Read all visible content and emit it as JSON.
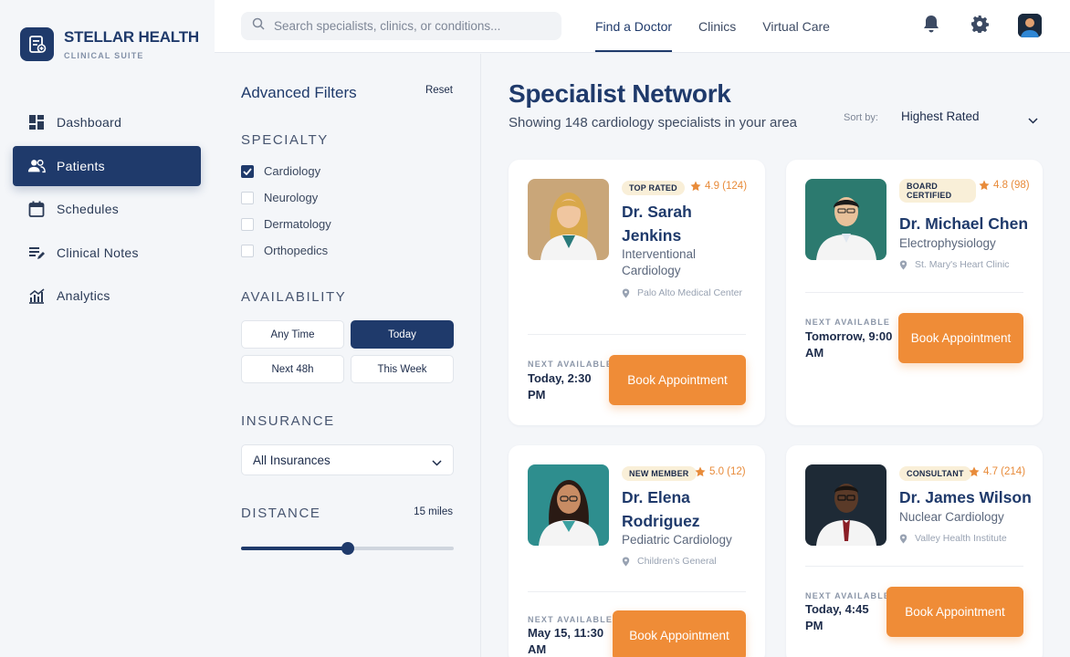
{
  "brand": {
    "name": "STELLAR HEALTH",
    "subtitle": "CLINICAL SUITE"
  },
  "sidebar": {
    "items": [
      {
        "label": "Dashboard",
        "icon": "dashboard-icon"
      },
      {
        "label": "Patients",
        "icon": "patients-icon",
        "active": true
      },
      {
        "label": "Schedules",
        "icon": "calendar-icon"
      },
      {
        "label": "Clinical Notes",
        "icon": "notes-icon"
      },
      {
        "label": "Analytics",
        "icon": "analytics-icon"
      }
    ]
  },
  "search": {
    "placeholder": "Search specialists, clinics, or conditions...",
    "value": ""
  },
  "tabs": [
    {
      "label": "Find a Doctor",
      "active": true
    },
    {
      "label": "Clinics"
    },
    {
      "label": "Virtual Care"
    }
  ],
  "filters": {
    "title": "Advanced Filters",
    "reset": "Reset",
    "specialty": {
      "heading": "SPECIALTY",
      "options": [
        {
          "label": "Cardiology",
          "checked": true
        },
        {
          "label": "Neurology",
          "checked": false
        },
        {
          "label": "Dermatology",
          "checked": false
        },
        {
          "label": "Orthopedics",
          "checked": false
        }
      ]
    },
    "availability": {
      "heading": "AVAILABILITY",
      "options": [
        "Any Time",
        "Today",
        "Next 48h",
        "This Week"
      ],
      "selected": "Today"
    },
    "insurance": {
      "heading": "INSURANCE",
      "value": "All Insurances"
    },
    "distance": {
      "heading": "DISTANCE",
      "value": "15 miles",
      "fraction": 0.5
    }
  },
  "main": {
    "title": "Specialist Network",
    "subtitle": "Showing 148 cardiology specialists in your area",
    "sort_label": "Sort by:",
    "sort_value": "Highest Rated",
    "next_available_label": "NEXT AVAILABLE",
    "book_label": "Book Appointment"
  },
  "doctors": [
    {
      "badge": "TOP RATED",
      "rating": "4.9 (124)",
      "name": "Dr. Sarah Jenkins",
      "specialty": "Interventional Cardiology",
      "location": "Palo Alto Medical Center",
      "next": "Today, 2:30 PM"
    },
    {
      "badge": "BOARD CERTIFIED",
      "rating": "4.8 (98)",
      "name": "Dr. Michael Chen",
      "specialty": "Electrophysiology",
      "location": "St. Mary's Heart Clinic",
      "next": "Tomorrow, 9:00 AM"
    },
    {
      "badge": "NEW MEMBER",
      "rating": "5.0 (12)",
      "name": "Dr. Elena Rodriguez",
      "specialty": "Pediatric Cardiology",
      "location": "Children's General",
      "next": "May 15, 11:30 AM"
    },
    {
      "badge": "CONSULTANT",
      "rating": "4.7 (214)",
      "name": "Dr. James Wilson",
      "specialty": "Nuclear Cardiology",
      "location": "Valley Health Institute",
      "next": "Today, 4:45 PM"
    }
  ],
  "colors": {
    "primary": "#1f3a6b",
    "accent": "#ef8c37",
    "badge_bg": "#f9efd8",
    "background": "#f4f6f9"
  }
}
